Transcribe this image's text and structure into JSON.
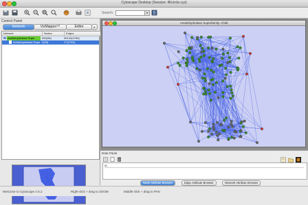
{
  "window": {
    "title": "Cytoscape Desktop (Session: 4Kcircle.cys)"
  },
  "toolbar": {
    "search_label": "Search:",
    "search_value": ""
  },
  "control_panel": {
    "title": "Control Panel",
    "tabs": [
      {
        "label": "Network"
      },
      {
        "label": "VizMapper™"
      },
      {
        "label": "Editor"
      }
    ],
    "columns": {
      "network": "Network",
      "nodes": "Nodes",
      "edges": "Edges"
    },
    "networks": [
      {
        "name": "Amidohydrolase Supe",
        "nodes": "959(98)",
        "edges": "50142(2765)"
      },
      {
        "name": "Amidohydrolase Supe",
        "nodes": "9(98)",
        "edges": "27(2765)"
      }
    ]
  },
  "network_view": {
    "title": "Amidohydrolase Superfamily--child"
  },
  "data_panel": {
    "title": "Data Panel",
    "id_header": "ID",
    "tabs": [
      {
        "label": "Node Attribute Browser"
      },
      {
        "label": "Edge Attribute Browser"
      },
      {
        "label": "Network Attribute Browser"
      }
    ]
  },
  "status": {
    "welcome": "Welcome to Cytoscape 2.6.2",
    "zoom_hint": "Right-click + drag  to  ZOOM",
    "pan_hint": "Middle-click + drag  to  PAN"
  },
  "colors": {
    "graph_bg": "#ccd0f4",
    "edge": "#2f4fe0",
    "node_green": "#3a8a2a",
    "node_gray": "#666666",
    "node_red": "#cc3333",
    "selection": "#3d79d8"
  }
}
